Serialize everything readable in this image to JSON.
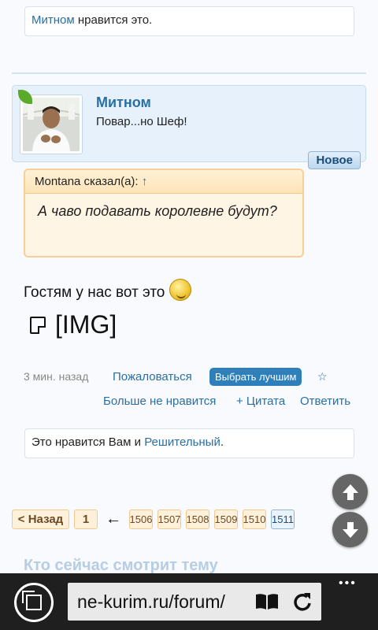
{
  "top_likes": {
    "user": "Митном",
    "text": " нравится это."
  },
  "post": {
    "username": "Митном",
    "user_title": "Повар...но Шеф!",
    "badge": "Новое",
    "quote": {
      "header": "Montana сказал(а):",
      "arrow": "↑",
      "body": "А чаво подавать королевне будут?"
    },
    "message": "Гостям у нас вот это",
    "image_placeholder": "[IMG]",
    "time": "3 мин. назад",
    "report": "Пожаловаться",
    "best_button": "Выбрать лучшим",
    "star": "☆",
    "unlike": "Больше не нравится",
    "quote_action": "+ Цитата",
    "reply": "Ответить"
  },
  "bottom_likes": {
    "prefix": "Это нравится Вам и ",
    "user": "Решительный",
    "suffix": "."
  },
  "pagination": {
    "back": "< Назад",
    "first": "1",
    "arrow": "←",
    "pages": [
      "1506",
      "1507",
      "1508",
      "1509",
      "1510"
    ],
    "current": "1511"
  },
  "section_title": "Кто сейчас смотрит тему",
  "browser": {
    "url": "ne-kurim.ru/forum/",
    "more": "•••"
  }
}
